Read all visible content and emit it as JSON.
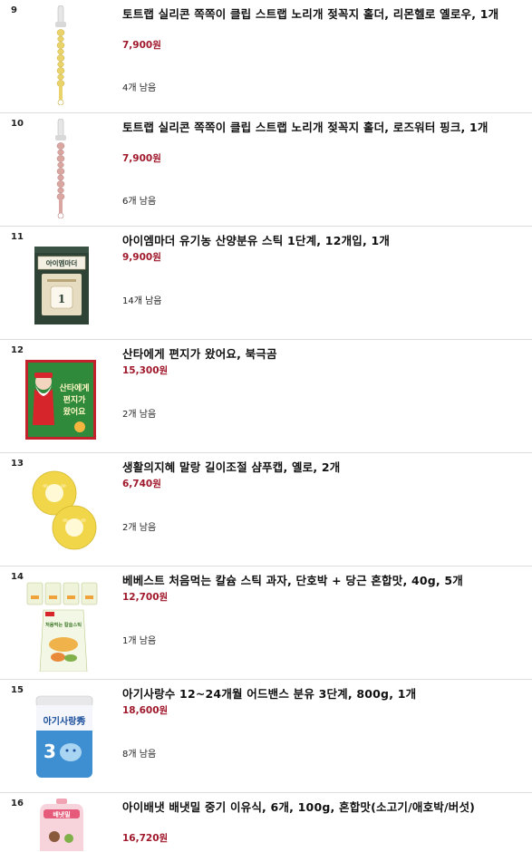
{
  "items": [
    {
      "rank": "9",
      "title": "토트랩 실리콘 쪽쪽이 클립 스트랩 노리개 젖꼭지 홀더, 리몬헬로 옐로우, 1개",
      "price": "7,900원",
      "stock": "4개 남음",
      "image": "pacifier-clip-yellow"
    },
    {
      "rank": "10",
      "title": "토트랩 실리콘 쪽쪽이 클립 스트랩 노리개 젖꼭지 홀더, 로즈워터 핑크, 1개",
      "price": "7,900원",
      "stock": "6개 남음",
      "image": "pacifier-clip-pink"
    },
    {
      "rank": "11",
      "title": "아이엠마더 유기농 산양분유 스틱 1단계, 12개입, 1개",
      "price": "9,900원",
      "stock": "14개 남음",
      "image": "formula-stick-box",
      "box_text": "아이엠마더"
    },
    {
      "rank": "12",
      "title": "산타에게 편지가 왔어요, 북극곰",
      "price": "15,300원",
      "stock": "2개 남음",
      "image": "santa-letter-book",
      "cover_text": [
        "산타에게",
        "편지가",
        "왔어요"
      ]
    },
    {
      "rank": "13",
      "title": "생활의지혜 말랑 길이조절 샴푸캡, 옐로, 2개",
      "price": "6,740원",
      "stock": "2개 남음",
      "image": "shampoo-cap-yellow"
    },
    {
      "rank": "14",
      "title": "베베스트 처음먹는 칼슘 스틱 과자, 단호박 + 당근 혼합맛, 40g, 5개",
      "price": "12,700원",
      "stock": "1개 남음",
      "image": "calcium-stick-snack",
      "pack_text": "처음먹는 칼슘스틱"
    },
    {
      "rank": "15",
      "title": "아기사랑수 12~24개월 어드밴스 분유 3단계, 800g, 1개",
      "price": "18,600원",
      "stock": "8개 남음",
      "image": "formula-can",
      "can_text": "아기사랑秀",
      "can_stage": "3"
    },
    {
      "rank": "16",
      "title": "아이배냇 배냇밀 중기 이유식, 6개, 100g, 혼합맛(소고기/애호박/버섯)",
      "price": "16,720원",
      "stock": "",
      "image": "baby-food-pouch",
      "pouch_text": "배냇밀"
    }
  ],
  "colors": {
    "price": "#a0182b",
    "divider": "#dcdcdc"
  }
}
